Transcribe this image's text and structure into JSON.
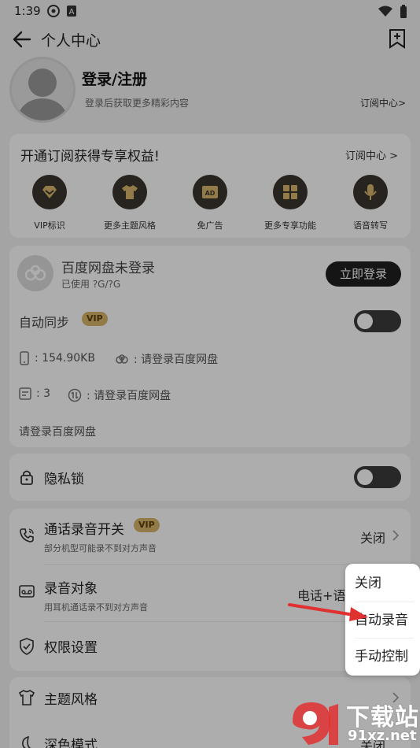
{
  "status_bar": {
    "time": "1:39"
  },
  "header": {
    "title": "个人中心"
  },
  "profile": {
    "title": "登录/注册",
    "subtitle": "登录后获取更多精彩内容",
    "subscription_link": "订阅中心>"
  },
  "vip_card": {
    "heading": "开通订阅获得专享权益!",
    "link": "订阅中心 >",
    "items": [
      {
        "label": "VIP标识",
        "icon": "vip-diamond-icon"
      },
      {
        "label": "更多主题风格",
        "icon": "shirt-icon"
      },
      {
        "label": "免广告",
        "icon": "ad-icon"
      },
      {
        "label": "更多专享功能",
        "icon": "grid-icon"
      },
      {
        "label": "语音转写",
        "icon": "microphone-icon"
      }
    ]
  },
  "baidu_pan": {
    "title": "百度网盘未登录",
    "used": "已使用 ?G/?G",
    "login_button": "立即登录",
    "auto_sync_label": "自动同步",
    "vip_badge": "VIP",
    "storage_size": ": 154.90KB",
    "storage_cloud": ": 请登录百度网盘",
    "file_count": ": 3",
    "file_sync": ": 请登录百度网盘",
    "hint": "请登录百度网盘"
  },
  "privacy": {
    "label": "隐私锁"
  },
  "recording": {
    "switch_label": "通话录音开关",
    "switch_badge": "VIP",
    "switch_sub": "部分机型可能录不到对方声音",
    "switch_value": "关闭",
    "target_label": "录音对象",
    "target_sub": "用耳机通话录不到对方声音",
    "target_value": "电话+语",
    "permission_label": "权限设置"
  },
  "theme": {
    "style_label": "主题风格",
    "dark_label": "深色模式",
    "dark_value": "关闭"
  },
  "popup": {
    "options": [
      "关闭",
      "自动录音",
      "手动控制"
    ]
  },
  "watermark": {
    "text": "下载站",
    "url": "91xz.net"
  },
  "colors": {
    "dark_circle": "#3a3530",
    "vip_gold": "#d8b56a",
    "arrow_red": "#e03030"
  }
}
